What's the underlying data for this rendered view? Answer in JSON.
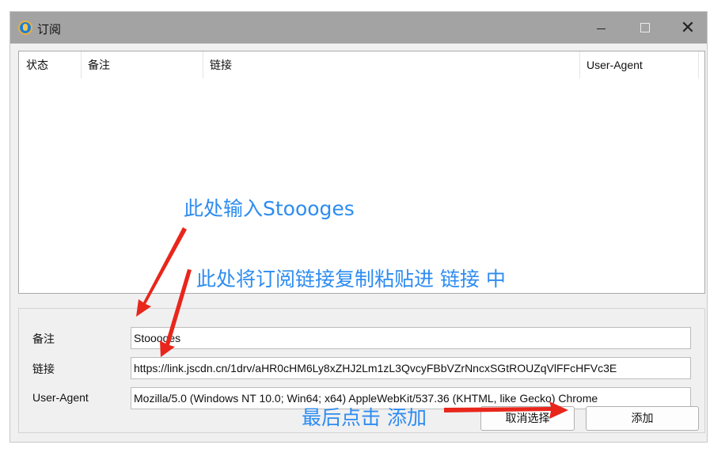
{
  "window": {
    "title": "订阅",
    "controls": {
      "minimize": "—",
      "maximize": "□",
      "close": "✕"
    }
  },
  "table": {
    "columns": [
      "状态",
      "备注",
      "链接",
      "User-Agent"
    ],
    "rows": []
  },
  "form": {
    "remark_label": "备注",
    "remark_value": "Stoooges",
    "link_label": "链接",
    "link_value": "https://link.jscdn.cn/1drv/aHR0cHM6Ly8xZHJ2Lm1zL3QvcyFBbVZrNncxSGtROUZqVlFFcHFVc3E",
    "ua_label": "User-Agent",
    "ua_value": "Mozilla/5.0 (Windows NT 10.0; Win64; x64) AppleWebKit/537.36 (KHTML, like Gecko) Chrome"
  },
  "buttons": {
    "cancel": "取消选择",
    "add": "添加"
  },
  "annotations": {
    "remark_hint": "此处输入Stoooges",
    "link_hint": "此处将订阅链接复制粘贴进 链接 中",
    "add_hint": "最后点击 添加"
  },
  "colors": {
    "titlebar": "#a3a3a3",
    "annotation_text": "#2d8cf0",
    "arrow": "#e8261c"
  },
  "icons": {
    "app": "app-logo-icon",
    "minimize": "minimize-icon",
    "maximize": "maximize-icon",
    "close": "close-icon"
  }
}
